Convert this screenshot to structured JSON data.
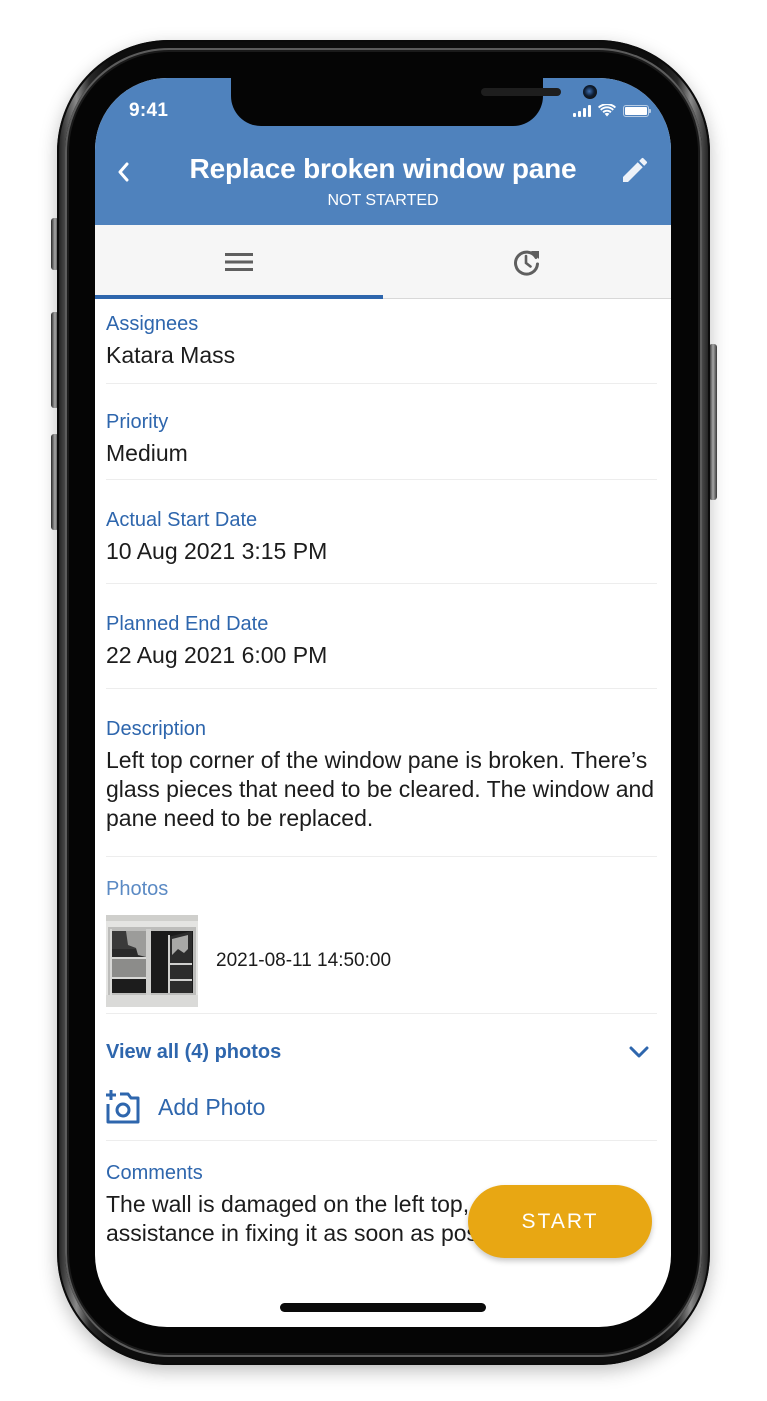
{
  "status_bar": {
    "time": "9:41",
    "icons": [
      "cellular-signal-icon",
      "wifi-icon",
      "battery-icon"
    ]
  },
  "header": {
    "title": "Replace broken window pane",
    "status": "NOT STARTED",
    "back_icon": "chevron-left-icon",
    "edit_icon": "pencil-icon",
    "color": "#4f82bd"
  },
  "tabs": [
    {
      "name": "details",
      "icon": "menu-icon",
      "active": true
    },
    {
      "name": "history",
      "icon": "clock-refresh-icon",
      "active": false
    }
  ],
  "fields": {
    "assignees": {
      "label": "Assignees",
      "value": "Katara Mass"
    },
    "priority": {
      "label": "Priority",
      "value": "Medium"
    },
    "actual_start": {
      "label": "Actual Start Date",
      "value": "10 Aug 2021 3:15 PM"
    },
    "planned_end": {
      "label": "Planned End Date",
      "value": "22 Aug 2021 6:00 PM"
    },
    "description": {
      "label": "Description",
      "value": "Left top corner of the window pane is broken. There’s glass pieces that need to be cleared. The window and pane need to be replaced."
    },
    "photos": {
      "label": "Photos",
      "items": [
        {
          "thumbnail": "broken-window-photo",
          "timestamp": "2021-08-11 14:50:00"
        }
      ],
      "view_all_label": "View all (4) photos",
      "add_photo_label": "Add Photo"
    },
    "comments": {
      "label": "Comments",
      "value": "The wall is damaged on the left top, please provide assistance in fixing it as soon as possible."
    }
  },
  "actions": {
    "start_label": "START",
    "start_color": "#e8a713"
  },
  "colors": {
    "accent": "#2e66ad",
    "text": "#1c1c1c",
    "divider": "#ededed"
  }
}
